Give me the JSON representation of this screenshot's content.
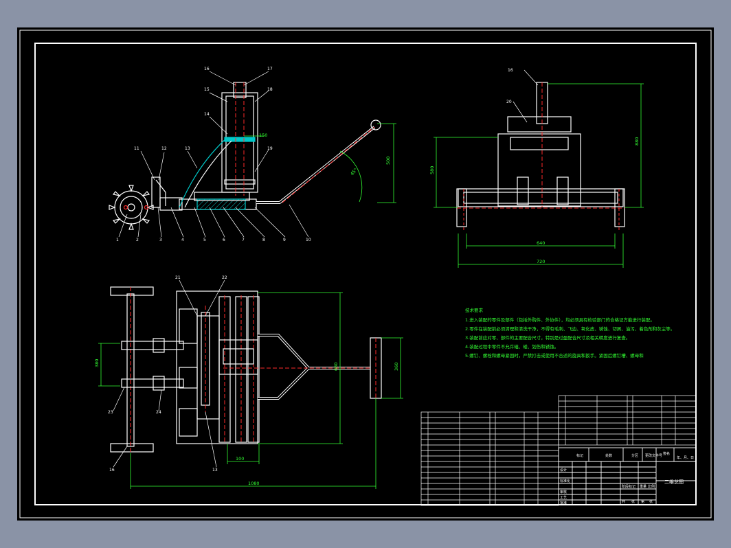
{
  "drawing": {
    "part_labels": [
      "1",
      "2",
      "3",
      "4",
      "5",
      "6",
      "7",
      "8",
      "9",
      "10",
      "11",
      "12",
      "13",
      "14",
      "15",
      "16",
      "17",
      "18",
      "19",
      "20",
      "21",
      "22",
      "23",
      "24"
    ],
    "dimensions": {
      "side_height": "500",
      "handle_angle": "45°",
      "front_total_height": "880",
      "front_body_height": "580",
      "front_inner_width": "640",
      "front_overall_width": "720",
      "plan_length": "1080",
      "plan_width": "680",
      "plan_wheel_track": "380",
      "plan_handle_width": "360",
      "plan_tooth_pitch": "100",
      "spring_dim": "150"
    },
    "tech_notes": {
      "title": "技术要求",
      "lines": [
        "1.进入装配的零件及部件（包括外购件、外协件），均必须具有检验部门的合格证方能进行装配。",
        "2.零件在装配前必须清理和清洗干净，不得有毛刺、飞边、氧化皮、锈蚀、切屑、油污、着色剂和灰尘等。",
        "3.装配前应对零、部件的主要配合尺寸，特别是过盈配合尺寸及相关精度进行复查。",
        "4.装配过程中零件不允许磕、碰、划伤和锈蚀。",
        "5.螺钉、螺栓和螺母紧固时，严禁打击或使用不合适的旋具和扳手。紧固后螺钉槽、螺母和"
      ]
    },
    "title_block": {
      "drawing_name": "二维总图",
      "header_cells": [
        "标记",
        "处数",
        "分区",
        "更改文件号",
        "签名",
        "年、月、日"
      ],
      "role_cells": [
        "设计",
        "标准化",
        "审核",
        "工艺",
        "批准"
      ],
      "stage_cells": [
        "阶段标记",
        "重量",
        "比例"
      ],
      "sheet_cells": [
        "共",
        "张",
        "第",
        "张"
      ]
    },
    "colors": {
      "background": "#8a93a6",
      "sheet": "#000000",
      "line": "#ffffff",
      "dimension": "#33ff33",
      "centerline": "#ff2a2a",
      "hatch": "#00c8c8"
    }
  }
}
